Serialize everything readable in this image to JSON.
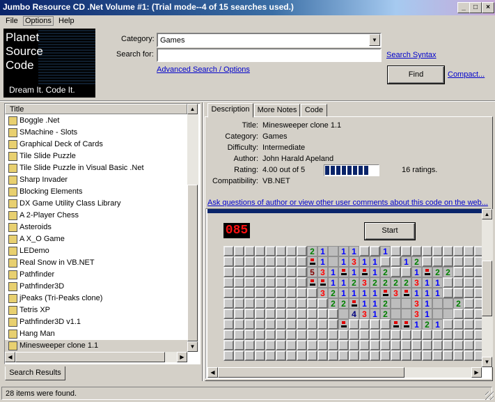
{
  "window": {
    "title": "Jumbo Resource CD .Net Volume #1: (Trial mode--4 of 15 searches used.)",
    "controls": {
      "minimize": "_",
      "maximize": "□",
      "close": "×"
    }
  },
  "menu": [
    "File",
    "Options",
    "Help"
  ],
  "logo": {
    "line1": "Planet",
    "line2": "Source",
    "line3": "Code",
    "tagline": "Dream It.  Code It."
  },
  "search": {
    "category_label": "Category:",
    "category_value": "Games",
    "search_for_label": "Search for:",
    "search_for_value": "",
    "search_syntax_link": "Search Syntax",
    "advanced_link": "Advanced Search / Options",
    "find_button": "Find",
    "compact_link": "Compact..."
  },
  "results": {
    "column_header": "Title",
    "items": [
      "Boggle .Net",
      "SMachine - Slots",
      "Graphical Deck of Cards",
      "Tile Slide Puzzle",
      "Tile Slide Puzzle in Visual Basic .Net",
      "Sharp Invader",
      "Blocking Elements",
      "DX Game Utility Class Library",
      "A 2-Player Chess",
      "Asteroids",
      "A X_O Game",
      "LEDemo",
      "Real Snow in VB.NET",
      "Pathfinder",
      "Pathfinder3D",
      "jPeaks (Tri-Peaks clone)",
      "Tetris XP",
      "Pathfinder3D v1.1",
      "Hang Man",
      "Minesweeper clone 1.1"
    ],
    "selected_index": 19,
    "tab_label": "Search Results"
  },
  "detail": {
    "tabs": [
      "Description",
      "More Notes",
      "Code"
    ],
    "fields": [
      {
        "label": "Title:",
        "value": "Minesweeper clone 1.1"
      },
      {
        "label": "Category:",
        "value": "Games"
      },
      {
        "label": "Difficulty:",
        "value": "Intermediate"
      },
      {
        "label": "Author:",
        "value": "John Harald Apeland"
      },
      {
        "label": "Rating:",
        "value": "4.00 out of 5"
      },
      {
        "label": "Compatibility:",
        "value": "VB.NET"
      }
    ],
    "rating_fraction": 0.8,
    "ratings_count": "16 ratings.",
    "ask_link": "Ask questions of author or view other user comments about this code on the web...",
    "screenshot": {
      "counter": "085",
      "start_button": "Start",
      "board": [
        "UUUUUUUU21O11UU1UUUUUUUUU",
        "UUUUUUUUF1O1311UU12UUUUUU",
        "UUUUUUUU531F1F12UU1F22UUU",
        "UUUUUUUUFF11232222311UUUU",
        "UUUUUUUUU321111F3F111UUUUU",
        "UUUUUUUUUU22F112OO31OO2UUU",
        "UUUUUUUUUUUO4312OO31OOUUUU",
        "UUUUUUUUUUUFUUUUFF121UUUUU",
        "UUUUUUUUUUUUUUUUUUUUUUUUU",
        "UUUUUUUUUUUUUUUUUUUUUUUUU",
        "UUUUUUUUUUUUUUUUUUUUUUUUU"
      ]
    }
  },
  "status": {
    "text": "28 items were found."
  }
}
